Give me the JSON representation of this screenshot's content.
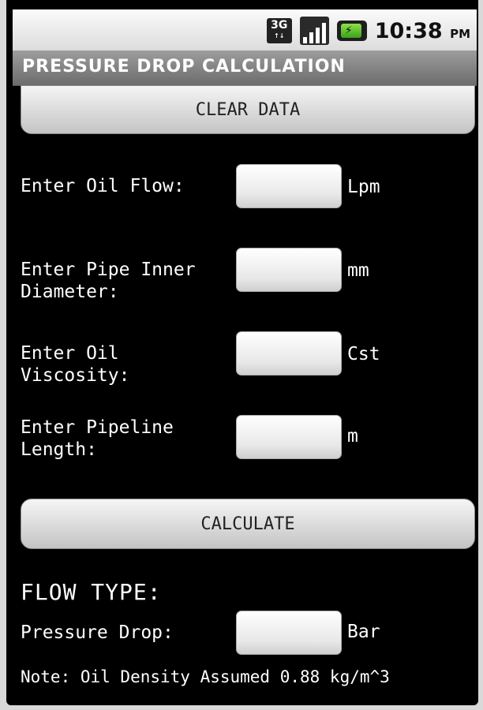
{
  "status_bar": {
    "network": "3G",
    "network_sub": "↑↓",
    "time": "10:38",
    "ampm": "PM",
    "icons": [
      "3g-icon",
      "signal-icon",
      "battery-icon"
    ]
  },
  "title": "PRESSURE DROP CALCULATION",
  "buttons": {
    "clear": "CLEAR DATA",
    "calculate": "CALCULATE"
  },
  "fields": [
    {
      "label": "Enter Oil Flow:",
      "value": "",
      "unit": "Lpm"
    },
    {
      "label": "Enter Pipe Inner\nDiameter:",
      "value": "",
      "unit": "mm"
    },
    {
      "label": "Enter Oil\nViscosity:",
      "value": "",
      "unit": "Cst"
    },
    {
      "label": "Enter Pipeline\nLength:",
      "value": "",
      "unit": "m"
    }
  ],
  "result": {
    "flow_type_label": "FLOW TYPE:",
    "pressure_label": "Pressure Drop:",
    "pressure_value": "",
    "pressure_unit": "Bar"
  },
  "note": "Note: Oil Density Assumed 0.88 kg/m^3"
}
